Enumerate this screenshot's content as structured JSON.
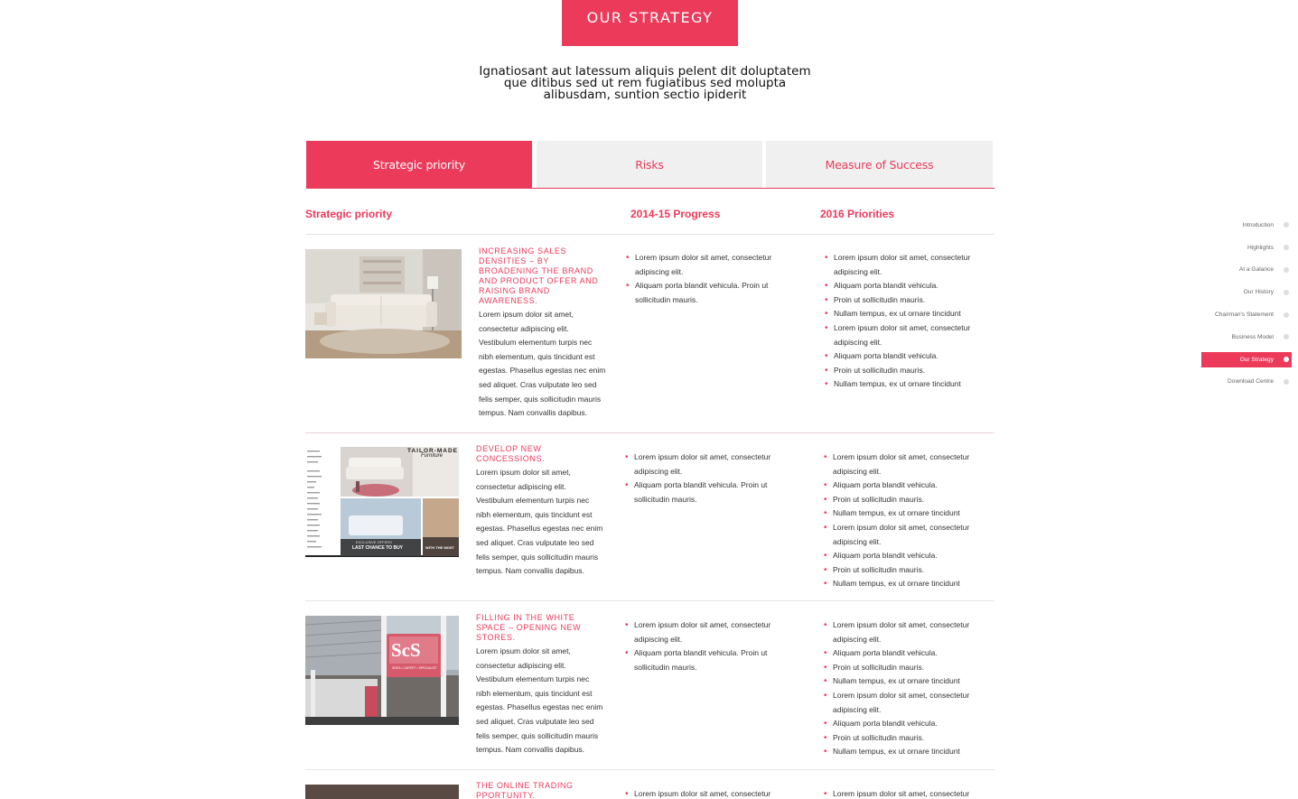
{
  "hero": {
    "button_label": "OUR STRATEGY",
    "intro": "Ignatiosant aut latessum aliquis pelent dit doluptatem que ditibus sed ut rem fugiatibus sed molupta alibusdam, suntion sectio ipiderit"
  },
  "tabs": [
    {
      "label": "Strategic priority",
      "active": true
    },
    {
      "label": "Risks",
      "active": false
    },
    {
      "label": "Measure of Success",
      "active": false
    }
  ],
  "columns": {
    "priority": "Strategic priority",
    "progress": "2014-15 Progress",
    "priorities": "2016 Priorities"
  },
  "rows": [
    {
      "title": "INCREASING SALES DENSITIES – BY BROADENING THE BRAND AND PRODUCT OFFER AND RAISING BRAND AWARENESS.",
      "body": "Lorem ipsum dolor sit amet, consectetur adipiscing elit. Vestibulum elementum turpis nec nibh elementum, quis tincidunt est egestas. Phasellus egestas nec enim sed aliquet. Cras vulputate leo sed felis semper, quis sollicitudin mauris tempus. Nam convallis dapibus.",
      "progress": [
        "Lorem ipsum dolor sit amet, consectetur adipiscing elit.",
        "Aliquam porta blandit vehicula. Proin ut sollicitudin mauris."
      ],
      "priorities": [
        "Lorem ipsum dolor sit amet, consectetur adipiscing elit.",
        "Aliquam porta blandit vehicula.",
        "Proin ut sollicitudin mauris.",
        "Nullam tempus, ex ut ornare tincidunt",
        "Lorem ipsum dolor sit amet, consectetur adipiscing elit.",
        "Aliquam porta blandit vehicula.",
        "Proin ut sollicitudin mauris.",
        "Nullam tempus, ex ut ornare tincidunt"
      ]
    },
    {
      "title": "DEVELOP NEW CONCESSIONS.",
      "body": "Lorem ipsum dolor sit amet, consectetur adipiscing elit. Vestibulum elementum turpis nec nibh elementum, quis tincidunt est egestas. Phasellus egestas nec enim sed aliquet. Cras vulputate leo sed felis semper, quis sollicitudin mauris tempus. Nam convallis dapibus.",
      "progress": [
        "Lorem ipsum dolor sit amet, consectetur adipiscing elit.",
        "Aliquam porta blandit vehicula. Proin ut sollicitudin mauris."
      ],
      "priorities": [
        "Lorem ipsum dolor sit amet, consectetur adipiscing elit.",
        "Aliquam porta blandit vehicula.",
        "Proin ut sollicitudin mauris.",
        "Nullam tempus, ex ut ornare tincidunt",
        "Lorem ipsum dolor sit amet, consectetur adipiscing elit.",
        "Aliquam porta blandit vehicula.",
        "Proin ut sollicitudin mauris.",
        "Nullam tempus, ex ut ornare tincidunt"
      ],
      "image_text": {
        "brand": "TAILOR-MADE",
        "brand_script": "Furniture",
        "offer_small": "EXCLUSIVE OFFERS",
        "offer": "LAST CHANCE TO BUY",
        "side": "WITH THE MOST"
      }
    },
    {
      "title": "FILLING IN THE WHITE SPACE – OPENING NEW STORES.",
      "body": "Lorem ipsum dolor sit amet, consectetur adipiscing elit. Vestibulum elementum turpis nec nibh elementum, quis tincidunt est egestas. Phasellus egestas nec enim sed aliquet. Cras vulputate leo sed felis semper, quis sollicitudin mauris tempus. Nam convallis dapibus.",
      "progress": [
        "Lorem ipsum dolor sit amet, consectetur adipiscing elit.",
        "Aliquam porta blandit vehicula. Proin ut sollicitudin mauris."
      ],
      "priorities": [
        "Lorem ipsum dolor sit amet, consectetur adipiscing elit.",
        "Aliquam porta blandit vehicula.",
        "Proin ut sollicitudin mauris.",
        "Nullam tempus, ex ut ornare tincidunt",
        "Lorem ipsum dolor sit amet, consectetur adipiscing elit.",
        "Aliquam porta blandit vehicula.",
        "Proin ut sollicitudin mauris.",
        "Nullam tempus, ex ut ornare tincidunt"
      ],
      "image_text": {
        "logo": "ScS",
        "sign": "SOFA • CARPET • SPECIALIST"
      }
    },
    {
      "title": "THE ONLINE TRADING PPORTUNITY.",
      "progress": [
        "Lorem ipsum dolor sit amet, consectetur"
      ],
      "priorities": [
        "Lorem ipsum dolor sit amet, consectetur"
      ]
    }
  ],
  "sidenav": [
    {
      "label": "Introduction",
      "active": false
    },
    {
      "label": "Highlights",
      "active": false
    },
    {
      "label": "At a Galance",
      "active": false
    },
    {
      "label": "Our History",
      "active": false
    },
    {
      "label": "Chairman's Statement",
      "active": false
    },
    {
      "label": "Business Model",
      "active": false
    },
    {
      "label": "Our Strategy",
      "active": true
    },
    {
      "label": "Download Centre",
      "active": false
    }
  ],
  "colors": {
    "accent": "#ec3a5b",
    "tab_bg": "#eff0ef"
  }
}
